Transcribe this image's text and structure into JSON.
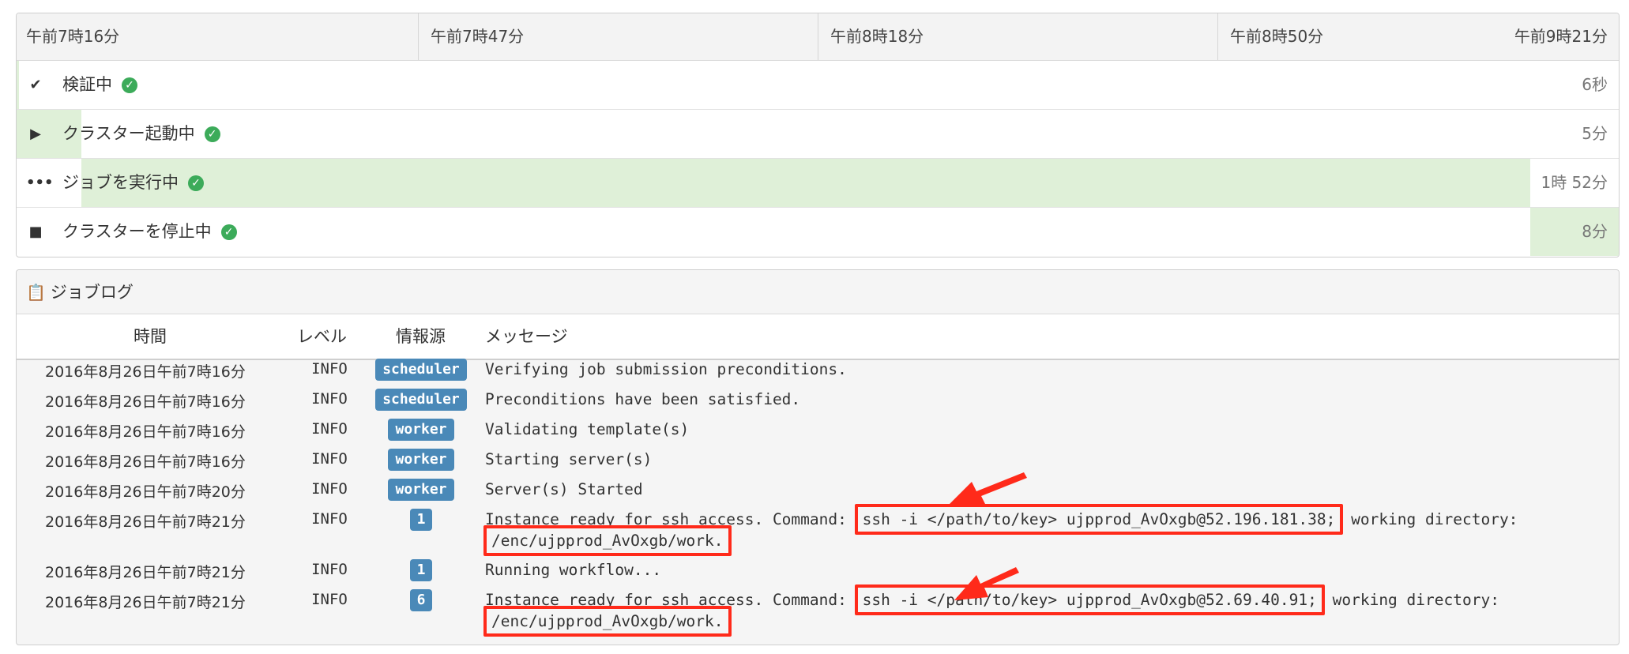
{
  "timeline": {
    "ticks": [
      "午前7時16分",
      "午前7時47分",
      "午前8時18分",
      "午前8時50分",
      "午前9時21分"
    ],
    "rows": [
      {
        "icon": "check-icon",
        "label": "検証中",
        "duration": "6秒"
      },
      {
        "icon": "play-icon",
        "label": "クラスター起動中",
        "duration": "5分"
      },
      {
        "icon": "ellipsis-icon",
        "label": "ジョブを実行中",
        "duration": "1時 52分"
      },
      {
        "icon": "stop-icon",
        "label": "クラスターを停止中",
        "duration": "8分"
      }
    ],
    "bar_color": "#dff0d8",
    "status_color": "#3cab5a"
  },
  "joblog": {
    "title": "ジョブログ",
    "columns": {
      "time": "時間",
      "level": "レベル",
      "source": "情報源",
      "message": "メッセージ"
    },
    "badge_color": "#4a89b8",
    "entries": [
      {
        "time": "2016年8月26日午前7時16分",
        "level": "INFO",
        "source": "scheduler",
        "message": "Verifying job submission preconditions."
      },
      {
        "time": "2016年8月26日午前7時16分",
        "level": "INFO",
        "source": "scheduler",
        "message": "Preconditions have been satisfied."
      },
      {
        "time": "2016年8月26日午前7時16分",
        "level": "INFO",
        "source": "worker",
        "message": "Validating template(s)"
      },
      {
        "time": "2016年8月26日午前7時16分",
        "level": "INFO",
        "source": "worker",
        "message": "Starting server(s)"
      },
      {
        "time": "2016年8月26日午前7時20分",
        "level": "INFO",
        "source": "worker",
        "message": "Server(s) Started"
      },
      {
        "time": "2016年8月26日午前7時21分",
        "level": "INFO",
        "source": "1",
        "message_prefix": "Instance ready for ssh access. Command: ",
        "command": "ssh -i </path/to/key> ujpprod_AvOxgb@52.196.181.38;",
        "message_middle": " working directory: ",
        "directory": "/enc/ujpprod_AvOxgb/work."
      },
      {
        "time": "2016年8月26日午前7時21分",
        "level": "INFO",
        "source": "1",
        "message": "Running workflow..."
      },
      {
        "time": "2016年8月26日午前7時21分",
        "level": "INFO",
        "source": "6",
        "message_prefix": "Instance ready for ssh access. Command: ",
        "command": "ssh -i </path/to/key> ujpprod_AvOxgb@52.69.40.91;",
        "message_middle": " working directory: ",
        "directory": "/enc/ujpprod_AvOxgb/work."
      }
    ]
  },
  "annotation_color": "#ff2a1a"
}
